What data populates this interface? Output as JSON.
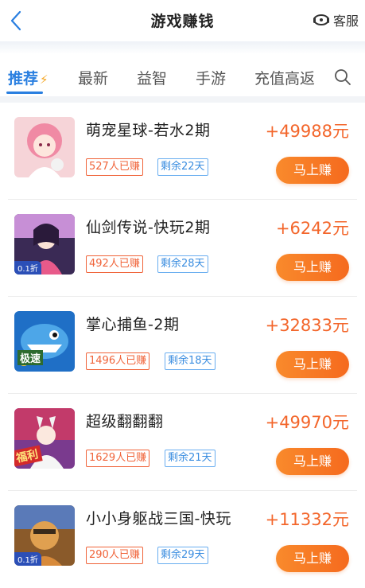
{
  "header": {
    "title": "游戏赚钱",
    "service_label": "客服"
  },
  "tabs": [
    {
      "label": "推荐",
      "active": true
    },
    {
      "label": "最新"
    },
    {
      "label": "益智"
    },
    {
      "label": "手游"
    },
    {
      "label": "充值高返"
    }
  ],
  "colors": {
    "accent": "#2a7fe0",
    "amount": "#f3662b",
    "button": "#f56a1e"
  },
  "items": [
    {
      "name": "萌宠星球-若水2期",
      "reward": "+49988元",
      "earned": "527人已赚",
      "remaining": "剩余22天",
      "button": "马上赚",
      "badge": ""
    },
    {
      "name": "仙剑传说-快玩2期",
      "reward": "+6242元",
      "earned": "492人已赚",
      "remaining": "剩余28天",
      "button": "马上赚",
      "badge": "0.1折"
    },
    {
      "name": "掌心捕鱼-2期",
      "reward": "+32833元",
      "earned": "1496人已赚",
      "remaining": "剩余18天",
      "button": "马上赚",
      "badge": "极速"
    },
    {
      "name": "超级翻翻翻",
      "reward": "+49970元",
      "earned": "1629人已赚",
      "remaining": "剩余21天",
      "button": "马上赚",
      "badge": "福利"
    },
    {
      "name": "小小身躯战三国-快玩",
      "reward": "+11332元",
      "earned": "290人已赚",
      "remaining": "剩余29天",
      "button": "马上赚",
      "badge": "0.1折"
    }
  ]
}
